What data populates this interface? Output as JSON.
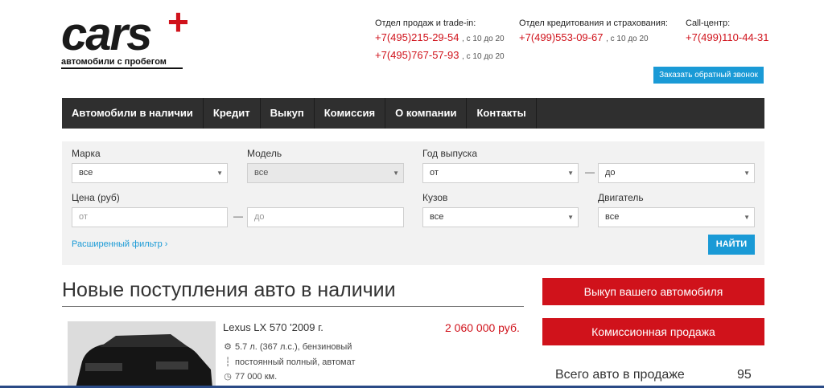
{
  "logo": {
    "word": "cars",
    "plus": "+",
    "tagline": "автомобили с пробегом"
  },
  "contacts": {
    "sales": {
      "label": "Отдел продаж и trade-in:",
      "phones": [
        {
          "number": "+7(495)215-29-54",
          "hours": ", с 10 до 20"
        },
        {
          "number": "+7(495)767-57-93",
          "hours": ", с 10 до 20"
        }
      ]
    },
    "credit": {
      "label": "Отдел кредитования и страхования:",
      "phones": [
        {
          "number": "+7(499)553-09-67",
          "hours": ", с 10 до 20"
        }
      ]
    },
    "callcenter": {
      "label": "Call-центр:",
      "phones": [
        {
          "number": "+7(499)110-44-31",
          "hours": ""
        }
      ]
    }
  },
  "callback_button": "Заказать обратный звонок",
  "nav": [
    "Автомобили в наличии",
    "Кредит",
    "Выкуп",
    "Комиссия",
    "О компании",
    "Контакты"
  ],
  "filter": {
    "brand": {
      "label": "Марка",
      "value": "все"
    },
    "model": {
      "label": "Модель",
      "value": "все"
    },
    "year": {
      "label": "Год выпуска",
      "from": "от",
      "to": "до"
    },
    "price": {
      "label": "Цена (руб)",
      "from_placeholder": "от",
      "to_placeholder": "до"
    },
    "body": {
      "label": "Кузов",
      "value": "все"
    },
    "engine": {
      "label": "Двигатель",
      "value": "все"
    },
    "dash": "—",
    "advanced": "Расширенный фильтр ›",
    "find": "НАЙТИ"
  },
  "section_title": "Новые поступления авто в наличии",
  "car": {
    "title": "Lexus LX 570 '2009 г.",
    "price": "2 060 000 руб.",
    "engine": "5.7 л. (367 л.с.), бензиновый",
    "drive": "постоянный полный, автомат",
    "mileage": "77 000 км."
  },
  "sidebar": {
    "buyout": "Выкуп вашего автомобиля",
    "commission": "Комиссионная продажа",
    "total_label": "Всего авто в продаже",
    "total_value": "95"
  },
  "icons": {
    "engine": "engine-icon",
    "drive": "gearbox-icon",
    "mileage": "clock-icon"
  },
  "colors": {
    "accent_red": "#d0121b",
    "accent_blue": "#1a9ad6",
    "nav_bg": "#2f2f2f"
  }
}
